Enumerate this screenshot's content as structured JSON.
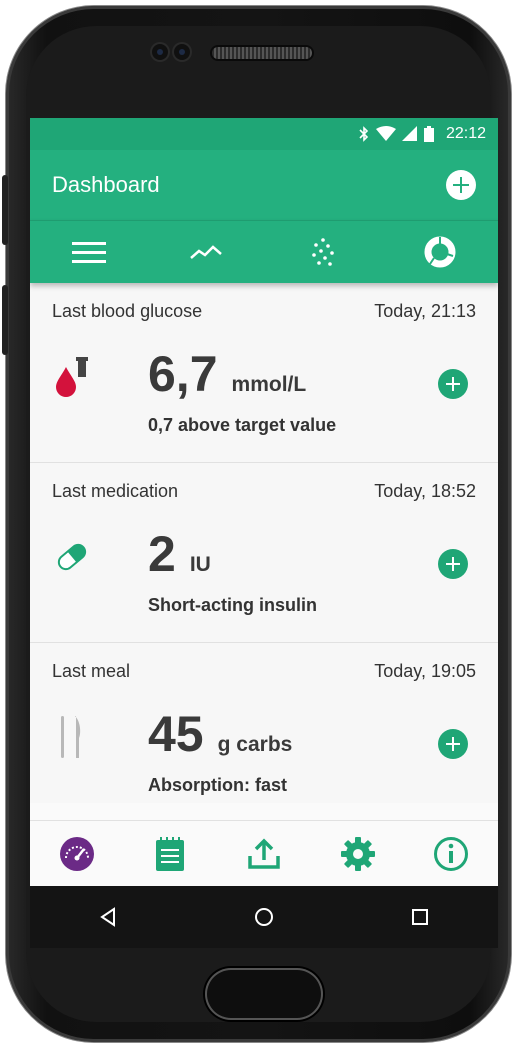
{
  "status": {
    "time": "22:12"
  },
  "appbar": {
    "title": "Dashboard"
  },
  "tabs": [
    "menu-icon",
    "trend-line-icon",
    "scatter-icon",
    "donut-chart-icon"
  ],
  "cards": [
    {
      "title": "Last blood glucose",
      "time": "Today, 21:13",
      "value": "6,7",
      "unit": "mmol/L",
      "subtitle": "0,7 above target value",
      "icon": "blood-drop-icon"
    },
    {
      "title": "Last medication",
      "time": "Today, 18:52",
      "value": "2",
      "unit": "IU",
      "subtitle": "Short-acting insulin",
      "icon": "pill-icon"
    },
    {
      "title": "Last meal",
      "time": "Today, 19:05",
      "value": "45",
      "unit": "g carbs",
      "subtitle": "Absorption: fast",
      "icon": "fork-knife-icon"
    }
  ],
  "bottom_nav": [
    "dashboard-gauge-icon",
    "logbook-icon",
    "export-icon",
    "settings-icon",
    "info-icon"
  ],
  "colors": {
    "primary": "#24b07f",
    "status": "#1fa676",
    "accent_purple": "#6b2a86",
    "drop_red": "#d3123c"
  }
}
